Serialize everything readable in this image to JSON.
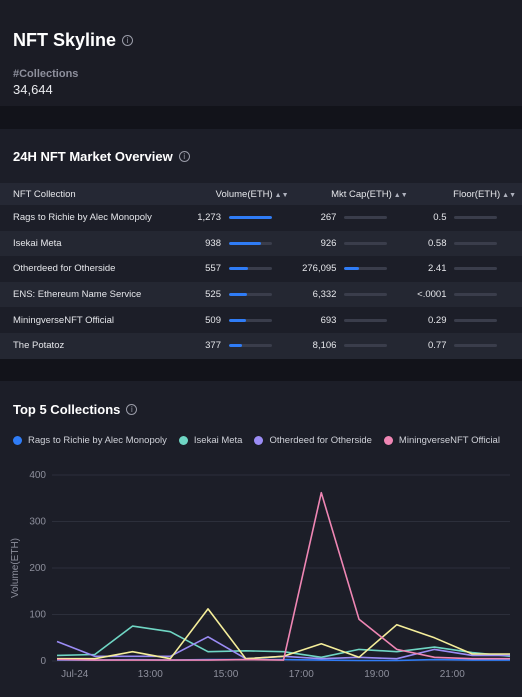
{
  "header": {
    "title": "NFT Skyline",
    "collections_label": "#Collections",
    "collections_value": "34,644"
  },
  "market": {
    "title": "24H NFT Market Overview",
    "columns": {
      "name": "NFT Collection",
      "volume": "Volume(ETH)",
      "mktcap": "Mkt Cap(ETH)",
      "floor": "Floor(ETH)"
    },
    "rows": [
      {
        "name": "Rags to Richie by Alec Monopoly",
        "volume": "1,273",
        "volume_pct": 1.0,
        "mktcap": "267",
        "mktcap_pct": 0.0,
        "floor": "0.5",
        "floor_pct": 0.0
      },
      {
        "name": "Isekai Meta",
        "volume": "938",
        "volume_pct": 0.74,
        "mktcap": "926",
        "mktcap_pct": 0.0,
        "floor": "0.58",
        "floor_pct": 0.0
      },
      {
        "name": "Otherdeed for Otherside",
        "volume": "557",
        "volume_pct": 0.44,
        "mktcap": "276,095",
        "mktcap_pct": 0.34,
        "floor": "2.41",
        "floor_pct": 0.0
      },
      {
        "name": "ENS: Ethereum Name Service",
        "volume": "525",
        "volume_pct": 0.41,
        "mktcap": "6,332",
        "mktcap_pct": 0.0,
        "floor": "<.0001",
        "floor_pct": 0.0
      },
      {
        "name": "MiningverseNFT Official",
        "volume": "509",
        "volume_pct": 0.4,
        "mktcap": "693",
        "mktcap_pct": 0.0,
        "floor": "0.29",
        "floor_pct": 0.0
      },
      {
        "name": "The Potatoz",
        "volume": "377",
        "volume_pct": 0.3,
        "mktcap": "8,106",
        "mktcap_pct": 0.0,
        "floor": "0.77",
        "floor_pct": 0.0
      }
    ]
  },
  "top5": {
    "title": "Top 5 Collections",
    "legend": [
      {
        "name": "Rags to Richie by Alec Monopoly",
        "color": "#2f7cf6"
      },
      {
        "name": "Isekai Meta",
        "color": "#6fd6c4"
      },
      {
        "name": "Otherdeed for Otherside",
        "color": "#9b8cf5"
      },
      {
        "name": "MiningverseNFT Official",
        "color": "#ef86b4"
      }
    ]
  },
  "chart_data": {
    "type": "line",
    "ylabel": "Volume(ETH)",
    "ylim": [
      0,
      400
    ],
    "yticks": [
      0,
      100,
      200,
      300,
      400
    ],
    "x_tick_labels": [
      "Jul-24",
      "13:00",
      "15:00",
      "17:00",
      "19:00",
      "21:00"
    ],
    "x": [
      0,
      1,
      2,
      3,
      4,
      5,
      6,
      7,
      8,
      9,
      10,
      11,
      12
    ],
    "series": [
      {
        "name": "Rags to Richie by Alec Monopoly",
        "color": "#2f7cf6",
        "values": [
          2,
          2,
          3,
          2,
          3,
          3,
          3,
          2,
          1,
          1,
          3,
          2,
          2
        ]
      },
      {
        "name": "Isekai Meta",
        "color": "#6fd6c4",
        "values": [
          12,
          14,
          75,
          63,
          20,
          22,
          20,
          8,
          25,
          20,
          30,
          18,
          10
        ]
      },
      {
        "name": "Otherdeed for Otherside",
        "color": "#9b8cf5",
        "values": [
          42,
          10,
          10,
          10,
          52,
          5,
          10,
          5,
          8,
          5,
          25,
          12,
          12
        ]
      },
      {
        "name": "",
        "color": "#f5ee9a",
        "values": [
          5,
          5,
          20,
          5,
          112,
          5,
          10,
          37,
          8,
          78,
          50,
          15,
          15
        ]
      },
      {
        "name": "MiningverseNFT Official",
        "color": "#ef86b4",
        "values": [
          3,
          2,
          2,
          2,
          2,
          3,
          2,
          362,
          90,
          25,
          8,
          5,
          5
        ]
      }
    ],
    "grid": true
  }
}
